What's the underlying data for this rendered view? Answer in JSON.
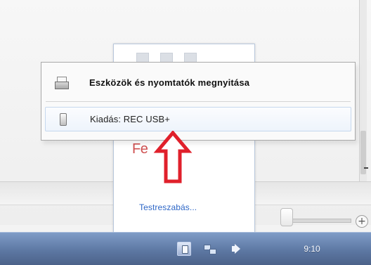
{
  "context_menu": {
    "items": [
      {
        "label": "Eszközök és nyomtatók megnyitása",
        "icon": "printer-icon"
      },
      {
        "label": "Kiadás: REC USB+",
        "icon": "usb-drive-icon"
      }
    ]
  },
  "panel": {
    "partial_text": "Fe",
    "customize_link": "Testreszabás..."
  },
  "taskbar": {
    "clock": "9:10",
    "tray_icons": [
      "usb-tray-icon",
      "network-icon",
      "volume-icon"
    ]
  },
  "colors": {
    "arrow": "#e0202b",
    "link": "#2e67c7",
    "taskbar": "#5d78a3",
    "menu_hover_border": "#c6d8ee"
  }
}
